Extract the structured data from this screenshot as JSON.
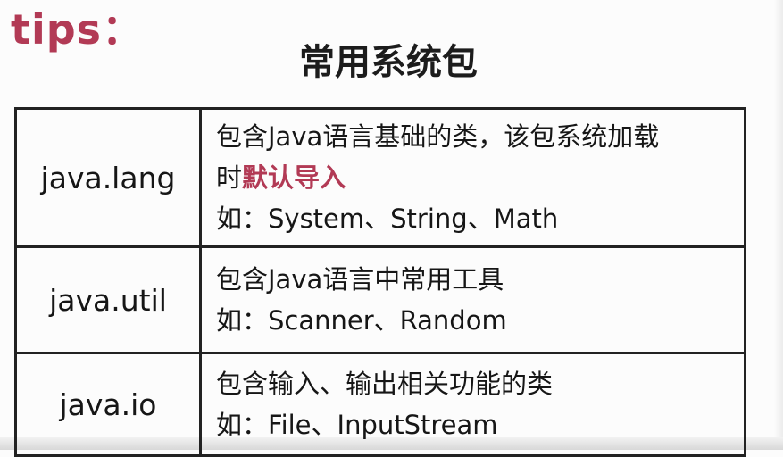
{
  "header": {
    "tips": "tips：",
    "title": "常用系统包"
  },
  "table": {
    "rows": [
      {
        "name": "java.lang",
        "desc_line1": "包含Java语言基础的类，该包系统加载",
        "desc_line2_pre": "时",
        "desc_line2_highlight": "默认导入",
        "example": "如：System、String、Math"
      },
      {
        "name": "java.util",
        "desc_line1": "包含Java语言中常用工具",
        "example": "如：Scanner、Random"
      },
      {
        "name": "java.io",
        "desc_line1": "包含输入、输出相关功能的类",
        "example": "如：File、InputStream"
      }
    ]
  },
  "colors": {
    "accent": "#b23a55",
    "text": "#151515",
    "border": "#222222"
  }
}
